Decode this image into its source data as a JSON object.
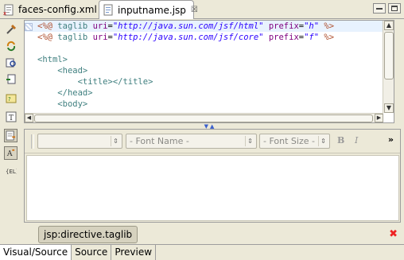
{
  "tabs": [
    {
      "label": "faces-config.xml",
      "active": false
    },
    {
      "label": "inputname.jsp",
      "active": true,
      "close": "☒"
    }
  ],
  "source": {
    "lines": [
      {
        "parts": [
          {
            "c": "tok-dir",
            "t": "<%@ "
          },
          {
            "c": "tok-tag",
            "t": "taglib "
          },
          {
            "c": "tok-attr",
            "t": "uri"
          },
          {
            "c": "tok-txt",
            "t": "="
          },
          {
            "c": "tok-str",
            "t": "\"http://java.sun.com/jsf/html\""
          },
          {
            "c": "tok-txt",
            "t": " "
          },
          {
            "c": "tok-attr",
            "t": "prefix"
          },
          {
            "c": "tok-txt",
            "t": "="
          },
          {
            "c": "tok-str",
            "t": "\"h\""
          },
          {
            "c": "tok-dir",
            "t": " %>"
          }
        ],
        "highlight": true
      },
      {
        "parts": [
          {
            "c": "tok-dir",
            "t": "<%@ "
          },
          {
            "c": "tok-tag",
            "t": "taglib "
          },
          {
            "c": "tok-attr",
            "t": "uri"
          },
          {
            "c": "tok-txt",
            "t": "="
          },
          {
            "c": "tok-str",
            "t": "\"http://java.sun.com/jsf/core\""
          },
          {
            "c": "tok-txt",
            "t": " "
          },
          {
            "c": "tok-attr",
            "t": "prefix"
          },
          {
            "c": "tok-txt",
            "t": "="
          },
          {
            "c": "tok-str",
            "t": "\"f\""
          },
          {
            "c": "tok-dir",
            "t": " %>"
          }
        ]
      },
      {
        "parts": []
      },
      {
        "parts": [
          {
            "c": "tok-tag",
            "t": "<html>"
          }
        ]
      },
      {
        "parts": [
          {
            "c": "tok-txt",
            "t": "    "
          },
          {
            "c": "tok-tag",
            "t": "<head>"
          }
        ]
      },
      {
        "parts": [
          {
            "c": "tok-txt",
            "t": "        "
          },
          {
            "c": "tok-tag",
            "t": "<title></title>"
          }
        ]
      },
      {
        "parts": [
          {
            "c": "tok-txt",
            "t": "    "
          },
          {
            "c": "tok-tag",
            "t": "</head>"
          }
        ]
      },
      {
        "parts": [
          {
            "c": "tok-txt",
            "t": "    "
          },
          {
            "c": "tok-tag",
            "t": "<body>"
          }
        ]
      }
    ]
  },
  "toolbar": {
    "style_combo": "",
    "font_name": "- Font Name -",
    "font_size": "- Font Size -",
    "bold": "B",
    "italic": "I",
    "more": "»"
  },
  "status": {
    "path": "jsp:directive.taglib",
    "close": "✖"
  },
  "bottom_tabs": [
    {
      "label": "Visual/Source",
      "active": true
    },
    {
      "label": "Source",
      "active": false
    },
    {
      "label": "Preview",
      "active": false
    }
  ],
  "palette_icons": [
    "tools-icon",
    "refresh-icon",
    "find-icon",
    "import-icon",
    "expression-icon",
    "text-icon",
    "selected-item-icon",
    "bundle-icon",
    "el-icon"
  ]
}
